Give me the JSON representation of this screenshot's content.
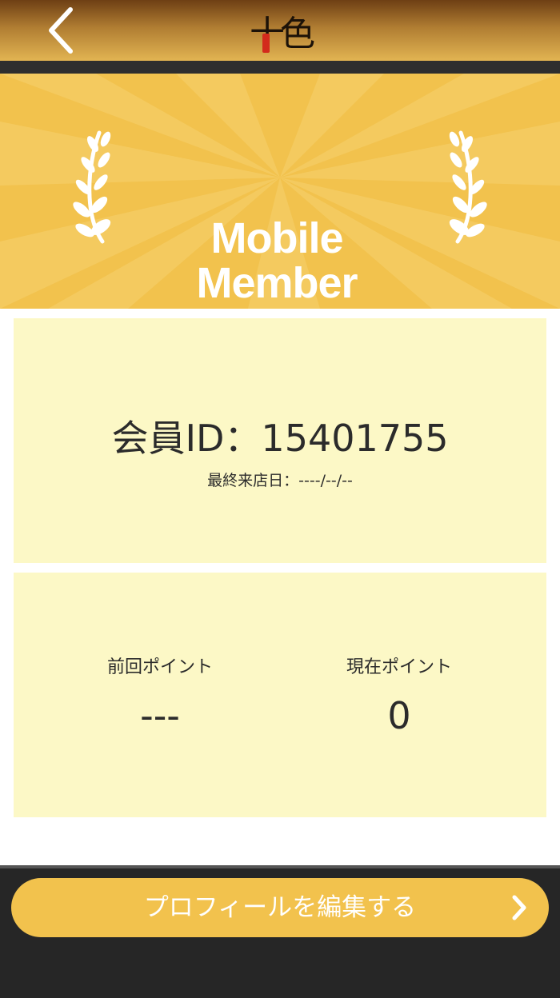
{
  "header": {
    "back_icon": "chevron-left-icon",
    "logo_text": "十色",
    "colors": {
      "top": "#6e3f14",
      "bottom": "#e2b452"
    }
  },
  "banner": {
    "title_line1": "Mobile",
    "title_line2": "Member",
    "background": "#f2c24d",
    "left_icon": "laurel-left-icon",
    "right_icon": "laurel-right-icon"
  },
  "member": {
    "id_text": "会員ID：15401755",
    "last_visit": "最終来店日：----/--/--"
  },
  "points": {
    "previous_label": "前回ポイント",
    "previous_value": "---",
    "current_label": "現在ポイント",
    "current_value": "0"
  },
  "footer": {
    "edit_profile_label": "プロフィールを編集する",
    "chevron_icon": "chevron-right-icon",
    "button_color": "#f2c24d"
  }
}
